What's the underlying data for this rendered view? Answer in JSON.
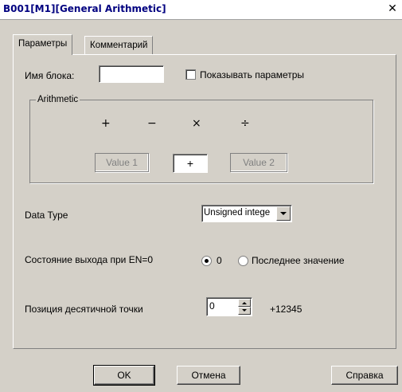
{
  "window": {
    "title": "B001[M1][General Arithmetic]",
    "close_glyph": "✕"
  },
  "tabs": [
    {
      "label": "Параметры"
    },
    {
      "label": "Комментарий"
    }
  ],
  "block_name": {
    "label": "Имя блока:",
    "value": ""
  },
  "show_params": {
    "label": "Показывать параметры",
    "checked": false
  },
  "arithmetic": {
    "legend": "Arithmetic",
    "operators": [
      "+",
      "−",
      "×",
      "÷"
    ],
    "value1": "Value 1",
    "selected_operator": "+",
    "value2": "Value 2"
  },
  "data_type": {
    "label": "Data Type",
    "value": "Unsigned intege"
  },
  "output_state": {
    "label": "Состояние выхода при EN=0",
    "option_zero": "0",
    "option_last": "Последнее значение",
    "selected": "0"
  },
  "decimal_point": {
    "label": "Позиция десятичной точки",
    "value": "0",
    "preview": "+12345"
  },
  "buttons": {
    "ok": "OK",
    "cancel": "Отмена",
    "help": "Справка"
  },
  "colors": {
    "face": "#d4d0c8",
    "title_text": "#000080"
  }
}
